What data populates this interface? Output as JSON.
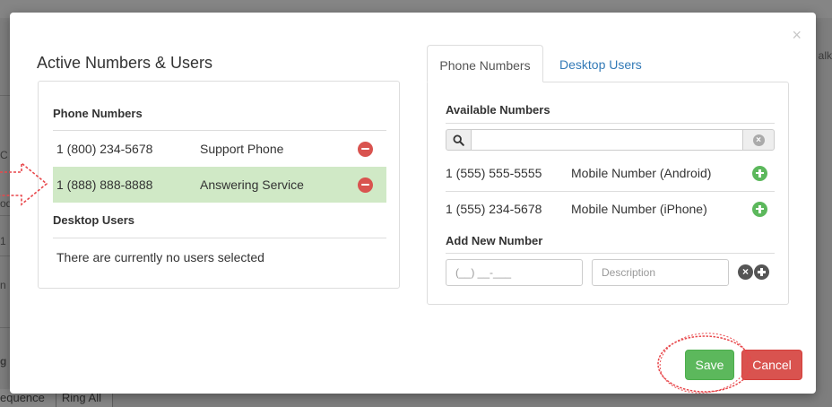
{
  "background": {
    "side_texts": [
      "C",
      "od",
      "1",
      "n",
      "g"
    ],
    "right_text": "alk",
    "bottom_tabs": [
      "equence",
      "Ring All"
    ]
  },
  "modal": {
    "close_glyph": "×",
    "left": {
      "title": "Active Numbers & Users",
      "phone_heading": "Phone Numbers",
      "phone_rows": [
        {
          "number": "1 (800) 234-5678",
          "description": "Support Phone",
          "active": false
        },
        {
          "number": "1 (888) 888-8888",
          "description": "Answering Service",
          "active": true
        }
      ],
      "desktop_heading": "Desktop Users",
      "no_users_text": "There are currently no users selected"
    },
    "right": {
      "tabs": [
        {
          "label": "Phone Numbers",
          "active": true
        },
        {
          "label": "Desktop Users",
          "active": false
        }
      ],
      "available_heading": "Available Numbers",
      "search_value": "",
      "available_rows": [
        {
          "number": "1 (555) 555-5555",
          "description": "Mobile Number (Android)"
        },
        {
          "number": "1 (555) 234-5678",
          "description": "Mobile Number (iPhone)"
        }
      ],
      "add_heading": "Add New Number",
      "number_placeholder": "(__) __-___",
      "description_placeholder": "Description"
    },
    "buttons": {
      "save": "Save",
      "cancel": "Cancel"
    }
  },
  "colors": {
    "active_row": "#d0e9c6",
    "remove": "#d9534f",
    "add": "#5cb85c",
    "link": "#337ab7",
    "annotation": "#e8474b"
  }
}
